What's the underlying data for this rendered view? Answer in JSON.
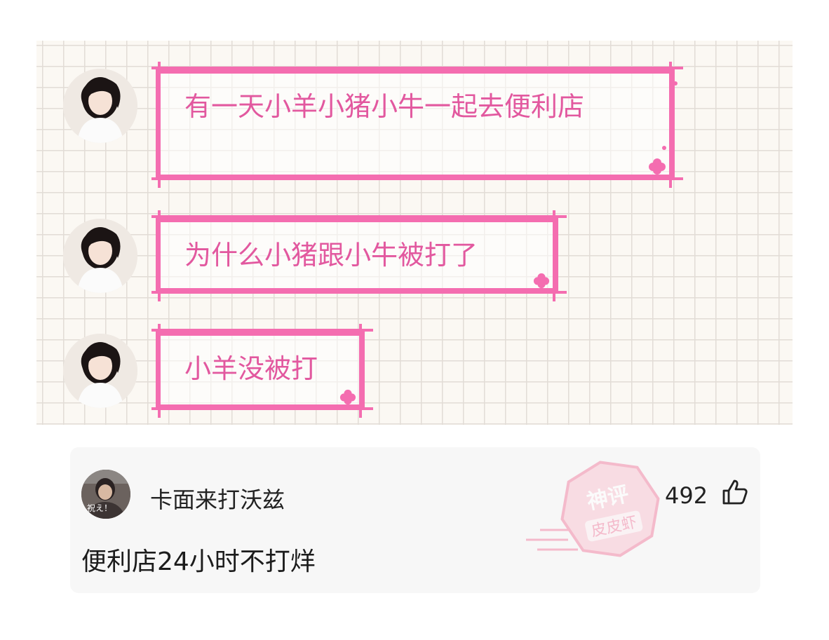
{
  "messages": [
    {
      "text": "有一天小羊小猪小牛一起去便利店"
    },
    {
      "text": "为什么小猪跟小牛被打了"
    },
    {
      "text": "小羊没被打"
    }
  ],
  "comment": {
    "username": "卡面来打沃兹",
    "avatar_caption": "祝え！",
    "text": "便利店24小时不打烊",
    "likes": "492"
  },
  "watermark": {
    "line1": "神评",
    "line2": "皮皮虾"
  },
  "colors": {
    "bubble_border": "#f46db0",
    "bubble_text": "#e2589f"
  },
  "icons": {
    "like": "thumbs-up-icon"
  }
}
